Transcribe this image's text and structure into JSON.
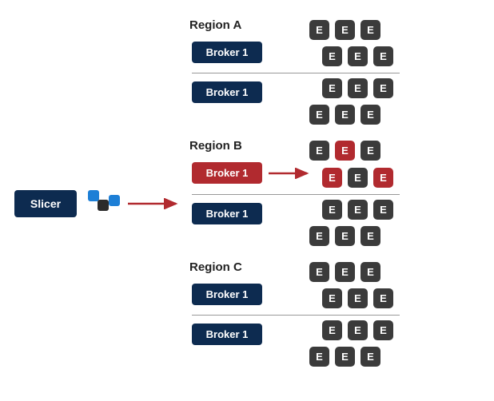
{
  "slicer": {
    "label": "Slicer"
  },
  "regions": [
    {
      "name": "Region A",
      "brokers": [
        {
          "label": "Broker 1",
          "highlighted": false
        },
        {
          "label": "Broker 1",
          "highlighted": false
        }
      ],
      "executor_rows": [
        {
          "items": [
            {
              "label": "E",
              "highlighted": false
            },
            {
              "label": "E",
              "highlighted": false
            },
            {
              "label": "E",
              "highlighted": false
            }
          ]
        },
        {
          "items": [
            {
              "label": "E",
              "highlighted": false
            },
            {
              "label": "E",
              "highlighted": false
            },
            {
              "label": "E",
              "highlighted": false
            }
          ]
        },
        {
          "items": [
            {
              "label": "E",
              "highlighted": false
            },
            {
              "label": "E",
              "highlighted": false
            },
            {
              "label": "E",
              "highlighted": false
            }
          ]
        },
        {
          "items": [
            {
              "label": "E",
              "highlighted": false
            },
            {
              "label": "E",
              "highlighted": false
            },
            {
              "label": "E",
              "highlighted": false
            }
          ]
        }
      ]
    },
    {
      "name": "Region B",
      "brokers": [
        {
          "label": "Broker 1",
          "highlighted": true
        },
        {
          "label": "Broker 1",
          "highlighted": false
        }
      ],
      "executor_rows": [
        {
          "items": [
            {
              "label": "E",
              "highlighted": false
            },
            {
              "label": "E",
              "highlighted": true
            },
            {
              "label": "E",
              "highlighted": false
            }
          ]
        },
        {
          "items": [
            {
              "label": "E",
              "highlighted": true
            },
            {
              "label": "E",
              "highlighted": false
            },
            {
              "label": "E",
              "highlighted": true
            }
          ]
        },
        {
          "items": [
            {
              "label": "E",
              "highlighted": false
            },
            {
              "label": "E",
              "highlighted": false
            },
            {
              "label": "E",
              "highlighted": false
            }
          ]
        },
        {
          "items": [
            {
              "label": "E",
              "highlighted": false
            },
            {
              "label": "E",
              "highlighted": false
            },
            {
              "label": "E",
              "highlighted": false
            }
          ]
        }
      ]
    },
    {
      "name": "Region C",
      "brokers": [
        {
          "label": "Broker 1",
          "highlighted": false
        },
        {
          "label": "Broker 1",
          "highlighted": false
        }
      ],
      "executor_rows": [
        {
          "items": [
            {
              "label": "E",
              "highlighted": false
            },
            {
              "label": "E",
              "highlighted": false
            },
            {
              "label": "E",
              "highlighted": false
            }
          ]
        },
        {
          "items": [
            {
              "label": "E",
              "highlighted": false
            },
            {
              "label": "E",
              "highlighted": false
            },
            {
              "label": "E",
              "highlighted": false
            }
          ]
        },
        {
          "items": [
            {
              "label": "E",
              "highlighted": false
            },
            {
              "label": "E",
              "highlighted": false
            },
            {
              "label": "E",
              "highlighted": false
            }
          ]
        },
        {
          "items": [
            {
              "label": "E",
              "highlighted": false
            },
            {
              "label": "E",
              "highlighted": false
            },
            {
              "label": "E",
              "highlighted": false
            }
          ]
        }
      ]
    }
  ],
  "arrows": [
    {
      "name": "slicer-to-regionB"
    },
    {
      "name": "broker-to-executors"
    }
  ],
  "colors": {
    "navy": "#0d2b50",
    "red": "#b12a2f",
    "dark": "#3b3b3b",
    "blue": "#1d7fd6"
  }
}
